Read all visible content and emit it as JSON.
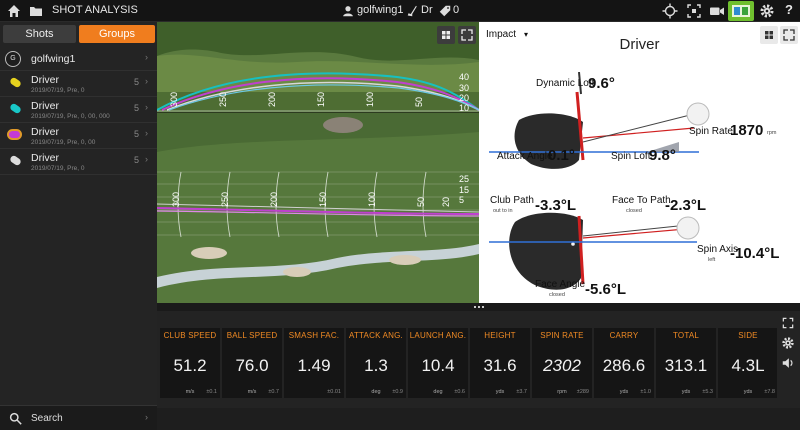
{
  "topbar": {
    "title": "SHOT ANALYSIS",
    "user": "golfwing1",
    "club": "Dr",
    "ball_count": "0"
  },
  "sidebar": {
    "tabs": [
      {
        "label": "Shots"
      },
      {
        "label": "Groups"
      }
    ],
    "user_item": {
      "badge": "G",
      "name": "golfwing1"
    },
    "items": [
      {
        "name": "Driver",
        "sub": "2019/07/19, Pre, 0",
        "count": "5",
        "color": "#e6d21e"
      },
      {
        "name": "Driver",
        "sub": "2019/07/19, Pre, 0, 00, 000",
        "count": "5",
        "color": "#19c8c8"
      },
      {
        "name": "Driver",
        "sub": "2019/07/19, Pre, 0, 00",
        "count": "5",
        "color": "#c43ad6"
      },
      {
        "name": "Driver",
        "sub": "2019/07/19, Pre, 0",
        "count": "5",
        "color": "#dcdcdc"
      }
    ],
    "search_label": "Search"
  },
  "shotview": {
    "side_distance_labels": [
      "300",
      "250",
      "200",
      "150",
      "100",
      "50"
    ],
    "side_height_labels": [
      "40",
      "30",
      "20",
      "10"
    ],
    "top_distance_labels": [
      "300",
      "250",
      "200",
      "150",
      "100",
      "50",
      "20"
    ],
    "top_width_labels": [
      "25",
      "15",
      "5"
    ]
  },
  "club_panel": {
    "view_select": "Impact",
    "title": "Driver",
    "dynamic_loft": {
      "label": "Dynamic Loft",
      "value": "9.6°"
    },
    "spin_rate": {
      "label": "Spin Rate",
      "value": "1870",
      "unit": "rpm"
    },
    "attack_angle": {
      "label": "Attack Angle",
      "value": "0.1°"
    },
    "spin_loft": {
      "label": "Spin Loft",
      "value": "9.8°"
    },
    "club_path": {
      "label": "Club Path",
      "value": "-3.3°L",
      "note": "out to in"
    },
    "face_to_path": {
      "label": "Face To Path",
      "value": "-2.3°L",
      "note": "closed"
    },
    "spin_axis": {
      "label": "Spin Axis",
      "value": "-10.4°L",
      "note": "left"
    },
    "face_angle": {
      "label": "Face Angle",
      "value": "-5.6°L",
      "note": "closed"
    }
  },
  "metrics": [
    {
      "label": "CLUB SPEED",
      "value": "51.2",
      "unit": "m/s",
      "tol": "±0.1"
    },
    {
      "label": "BALL SPEED",
      "value": "76.0",
      "unit": "m/s",
      "tol": "±0.7"
    },
    {
      "label": "SMASH FAC.",
      "value": "1.49",
      "unit": "",
      "tol": "±0.01"
    },
    {
      "label": "ATTACK ANG.",
      "value": "1.3",
      "unit": "deg",
      "tol": "±0.9"
    },
    {
      "label": "LAUNCH ANG.",
      "value": "10.4",
      "unit": "deg",
      "tol": "±0.6"
    },
    {
      "label": "HEIGHT",
      "value": "31.6",
      "unit": "yds",
      "tol": "±3.7"
    },
    {
      "label": "SPIN RATE",
      "value": "2302",
      "unit": "rpm",
      "tol": "±289"
    },
    {
      "label": "CARRY",
      "value": "286.6",
      "unit": "yds",
      "tol": "±1.0"
    },
    {
      "label": "TOTAL",
      "value": "313.1",
      "unit": "yds",
      "tol": "±5.3"
    },
    {
      "label": "SIDE",
      "value": "4.3L",
      "unit": "yds",
      "tol": "±7.8"
    }
  ]
}
